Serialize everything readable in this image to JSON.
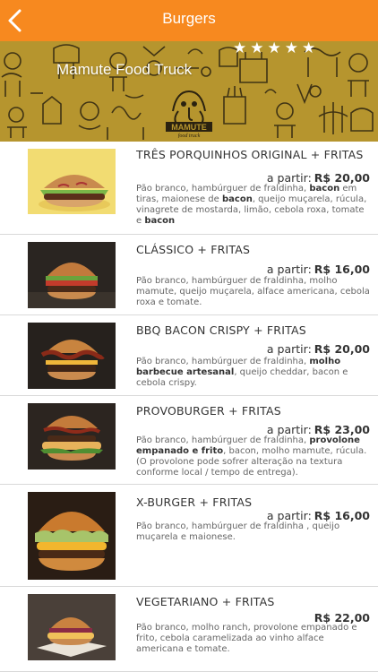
{
  "nav": {
    "title": "Burgers",
    "back_icon": "chevron-left-icon"
  },
  "banner": {
    "store_name": "Mamute Food Truck",
    "rating": 5,
    "logo_text": "MAMUTE"
  },
  "items": [
    {
      "title": "TRÊS PORQUINHOS ORIGINAL + FRITAS",
      "price_prefix": "a partir:",
      "price": "R$ 20,00",
      "desc": [
        [
          "Pão branco, hambúrguer de fraldinha, ",
          false
        ],
        [
          "bacon",
          true
        ],
        [
          " em tiras, maionese de ",
          false
        ],
        [
          "bacon",
          true
        ],
        [
          ", queijo muçarela, rúcula, vinagrete de mostarda, limão, cebola roxa, tomate e ",
          false
        ],
        [
          "bacon",
          true
        ]
      ]
    },
    {
      "title": "CLÁSSICO + FRITAS",
      "price_prefix": "a partir:",
      "price": "R$ 16,00",
      "desc": [
        [
          "Pão branco, hambúrguer de fraldinha, molho mamute, queijo muçarela, alface americana, cebola roxa e tomate.",
          false
        ]
      ]
    },
    {
      "title": "BBQ BACON CRISPY + FRITAS",
      "price_prefix": "a partir:",
      "price": "R$ 20,00",
      "desc": [
        [
          "Pão branco, hambúrguer de fraldinha, ",
          false
        ],
        [
          "molho barbecue artesanal",
          true
        ],
        [
          ", queijo cheddar, bacon e cebola crispy.",
          false
        ]
      ]
    },
    {
      "title": "PROVOBURGER + FRITAS",
      "price_prefix": "a partir:",
      "price": "R$ 23,00",
      "desc": [
        [
          "Pão branco, hambúrguer de fraldinha, ",
          false
        ],
        [
          "provolone empanado e frito",
          true
        ],
        [
          ", bacon, molho mamute, rúcula. (O provolone pode sofrer alteração na textura conforme local / tempo de entrega).",
          false
        ]
      ]
    },
    {
      "title": "X-BURGER + FRITAS",
      "price_prefix": "a partir:",
      "price": "R$ 16,00",
      "desc": [
        [
          "Pão branco, hambúrguer de fraldinha , queijo muçarela e maionese.",
          false
        ]
      ]
    },
    {
      "title": "VEGETARIANO + FRITAS",
      "price_prefix": "",
      "price": "R$ 22,00",
      "desc": [
        [
          "Pão branco, molho ranch, provolone empanado e frito, cebola caramelizada ao vinho alface americana e tomate.",
          false
        ]
      ]
    }
  ],
  "colors": {
    "accent": "#f7891f",
    "banner": "#b6952e"
  }
}
